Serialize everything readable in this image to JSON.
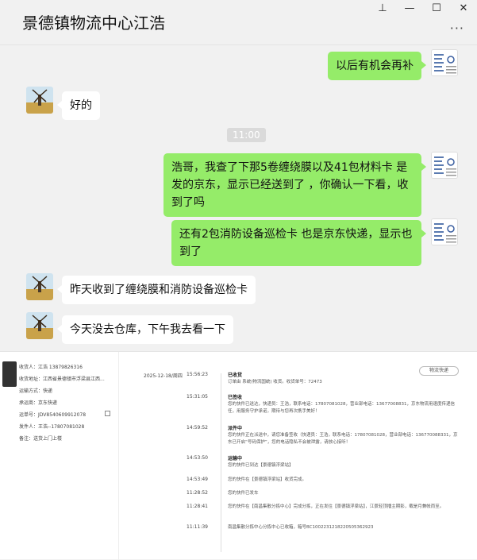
{
  "window": {
    "title": "景德镇物流中心江浩",
    "controls": {
      "pin": "⊥",
      "minimize": "—",
      "maximize": "☐",
      "close": "✕"
    },
    "more": "···"
  },
  "messages": [
    {
      "side": "right",
      "text": "以后有机会再补"
    },
    {
      "side": "left",
      "text": "好的"
    },
    {
      "side": "time",
      "text": "11:00"
    },
    {
      "side": "right",
      "text": "浩哥，我查了下那5卷缠绕膜以及41包材料卡  是发的京东，显示已经送到了 ，你确认一下看，收到了吗"
    },
    {
      "side": "right",
      "text": "还有2包消防设备巡检卡  也是京东快递，显示也到了"
    },
    {
      "side": "left",
      "text": "昨天收到了缠绕膜和消防设备巡检卡"
    },
    {
      "side": "left",
      "text": "今天没去仓库，下午我去看一下"
    }
  ],
  "shipment": {
    "info": [
      "收货人：江浩  13879826316",
      "收货地址：江西省景德镇市浮梁县江西...",
      "运输方式：快递",
      "承运商：京东快递",
      "运单号：JDV8540609912078",
      "发件人：王浩--17807081028",
      "备注：送货上门上楼"
    ],
    "date": "2025-12-18/周四",
    "track_button": "物流快递",
    "events": [
      {
        "time": "15:56:23",
        "status": "已收货",
        "desc": "订单由 系统(物流国统) 收货。收货单号：72473"
      },
      {
        "time": "15:31:05",
        "status": "已签收",
        "desc": "您的快件已送达，快递员：王浩，联系电话：17807081028，营业部电话：13677008831，京东物流用速度传递信任，用服务守护承诺，期待与您再次携手美好！"
      },
      {
        "time": "14:59:52",
        "status": "派件中",
        "desc": "您的快件正在派送中，请您准备签收（快递员：王浩，联系电话：17807081028，营业部电话：136770088331，京东已开启“号码保护”，您的电话隐私不会被泄露，请放心接听！"
      },
      {
        "time": "14:53:50",
        "status": "运输中",
        "desc": "您的快件已到达【景德镇浮梁站】"
      },
      {
        "time": "14:53:49",
        "status": "",
        "desc": "您的快件在【景德镇浮梁站】收货完成。"
      },
      {
        "time": "11:28:52",
        "status": "",
        "desc": "您的快件已发车"
      },
      {
        "time": "11:28:41",
        "status": "",
        "desc": "您的快件在【南昌集散分拣中心】完成分拣，正在发往【景德镇浮梁站】，江景轻顶播主期影，载是月兼帐而至。"
      },
      {
        "time": "11:11:39",
        "status": "",
        "desc": "南昌集散分拣中心分拣中心已收箱，箱号BC1002231218220505362923"
      }
    ]
  }
}
